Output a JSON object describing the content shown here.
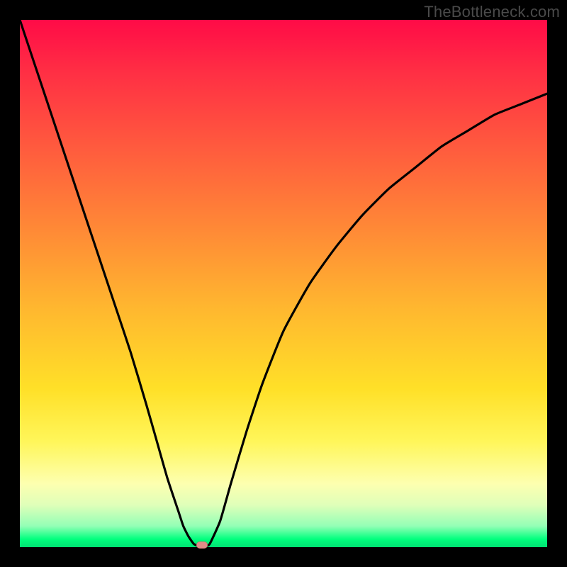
{
  "watermark": "TheBottleneck.com",
  "colors": {
    "page_bg": "#000000",
    "watermark_text": "#4a4a4a",
    "gradient_stops": [
      "#ff0b47",
      "#ff2f44",
      "#ff5a3e",
      "#ff8a36",
      "#ffb82f",
      "#ffe028",
      "#fff65a",
      "#fdffb0",
      "#dfffb9",
      "#93ffb6",
      "#00ff7e",
      "#00e173"
    ],
    "curve_stroke": "#000000",
    "marker_fill": "#e28b88"
  },
  "chart_data": {
    "type": "line",
    "title": "",
    "xlabel": "",
    "ylabel": "",
    "xlim": [
      0,
      100
    ],
    "ylim": [
      0,
      100
    ],
    "grid": false,
    "legend": false,
    "annotations": [],
    "series": [
      {
        "name": "bottleneck-curve",
        "x": [
          0,
          3,
          6,
          9,
          12,
          15,
          18,
          21,
          24,
          26,
          28,
          30,
          31,
          32,
          33,
          34,
          35,
          36,
          38,
          40,
          43,
          46,
          50,
          55,
          60,
          65,
          70,
          75,
          80,
          85,
          90,
          95,
          100
        ],
        "values": [
          100,
          91,
          82,
          73,
          64,
          55,
          46,
          37,
          27,
          20,
          13,
          7,
          4,
          2,
          0.6,
          0.2,
          0.2,
          0.6,
          5,
          12,
          22,
          31,
          41,
          50,
          57,
          63,
          68,
          72,
          76,
          79,
          82,
          84,
          86
        ]
      }
    ],
    "marker": {
      "name": "bottleneck-point",
      "x": 34.5,
      "y": 0.4
    }
  }
}
